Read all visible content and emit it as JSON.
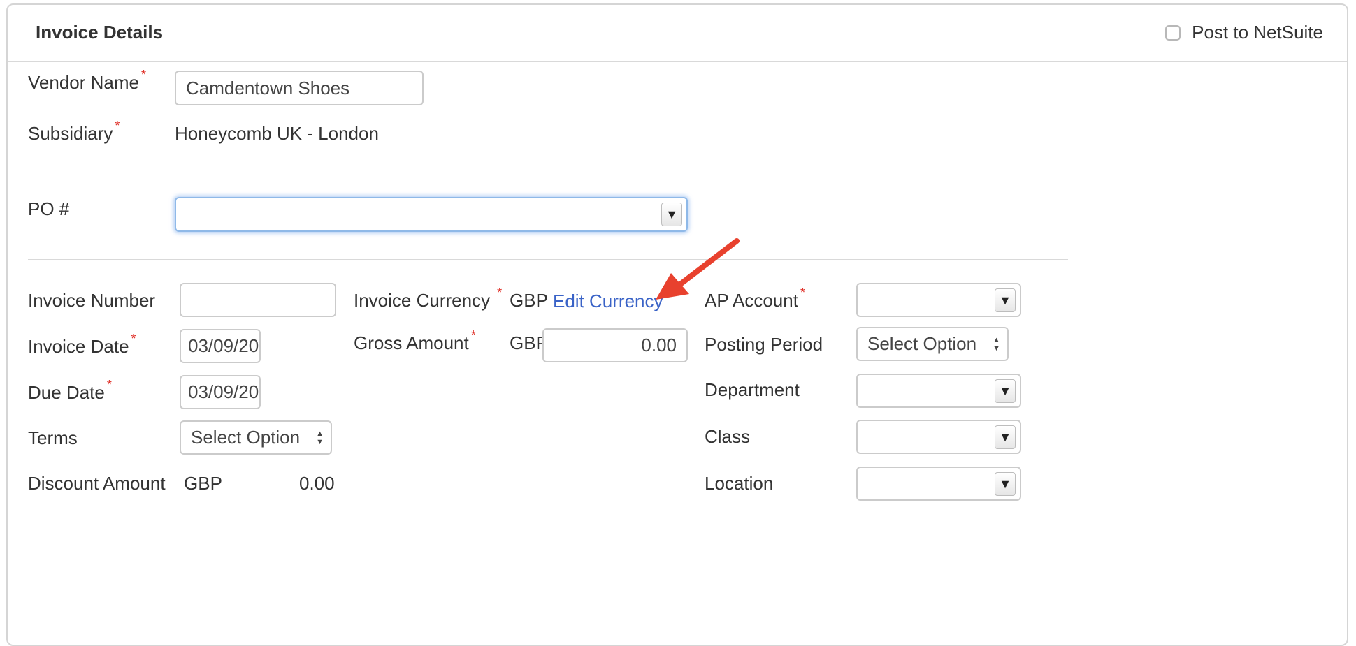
{
  "header": {
    "title": "Invoice Details",
    "post_label": "Post to NetSuite"
  },
  "vendor": {
    "label": "Vendor Name",
    "required": "*",
    "value": "Camdentown Shoes"
  },
  "subsidiary": {
    "label": "Subsidiary",
    "required": "*",
    "value": "Honeycomb UK - London"
  },
  "po": {
    "label": "PO #",
    "value": "",
    "dropdown_icon": "▼"
  },
  "invoice_number": {
    "label": "Invoice Number",
    "value": ""
  },
  "invoice_date": {
    "label": "Invoice Date",
    "required": "*",
    "value": "03/09/20"
  },
  "due_date": {
    "label": "Due Date",
    "required": "*",
    "value": "03/09/20"
  },
  "terms": {
    "label": "Terms",
    "value": "Select Option"
  },
  "discount": {
    "label": "Discount Amount",
    "currency": "GBP",
    "value": "0.00"
  },
  "invoice_currency": {
    "label": "Invoice Currency",
    "required": "*",
    "value": "GBP",
    "edit_link": "Edit Currency"
  },
  "gross_amount": {
    "label": "Gross Amount",
    "required": "*",
    "currency": "GBP",
    "value": "0.00"
  },
  "ap_account": {
    "label": "AP Account",
    "required": "*",
    "value": ""
  },
  "posting_period": {
    "label": "Posting Period",
    "value": "Select Option"
  },
  "department": {
    "label": "Department",
    "value": ""
  },
  "class": {
    "label": "Class",
    "value": ""
  },
  "location": {
    "label": "Location",
    "value": ""
  },
  "icons": {
    "dropdown": "▼",
    "select_up": "▲",
    "select_down": "▼"
  },
  "colors": {
    "required": "#e0322a",
    "link": "#3a63c7",
    "annotation_arrow": "#e8412e",
    "focus_border": "#8fb9e8"
  }
}
